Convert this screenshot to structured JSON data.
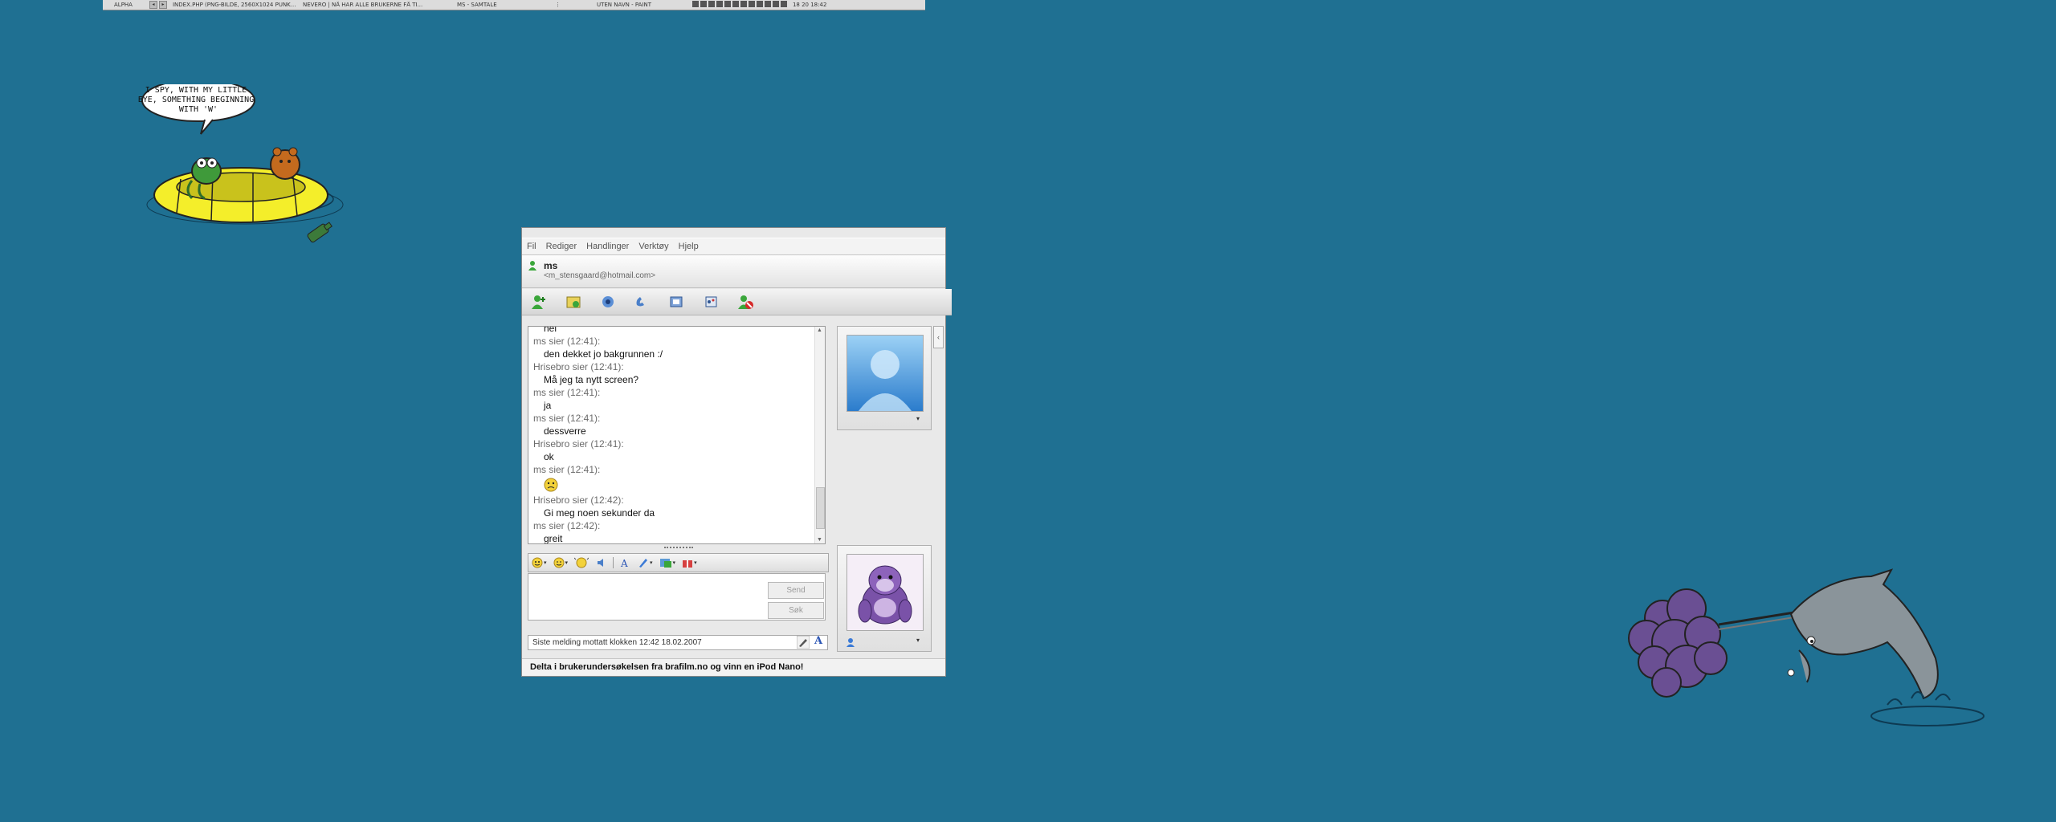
{
  "taskbar": {
    "items": [
      "ALPHA",
      "INDEX.PHP (PNG-BILDE, 2560X1024 PUNK...",
      "NEVERO | NÅ HAR ALLE BRUKERNE FÅ TI...",
      "MS - SAMTALE",
      "UTEN NAVN - PAINT"
    ],
    "clock": "18 20 18:42"
  },
  "desktop": {
    "speech_bubble_text": "I SPY, WITH MY LITTLE EYE, SOMETHING BEGINNING WITH 'W'"
  },
  "msn": {
    "menu": [
      "Fil",
      "Rediger",
      "Handlinger",
      "Verktøy",
      "Hjelp"
    ],
    "contact": {
      "name": "ms",
      "email": "<m_stensgaard@hotmail.com>"
    },
    "toolbar_icons": [
      "invite-contact-icon",
      "send-file-icon",
      "video-icon",
      "voice-icon",
      "activities-icon",
      "games-icon",
      "block-icon"
    ],
    "chat": [
      {
        "type": "msg",
        "text": "nei"
      },
      {
        "type": "sender",
        "text": "ms sier (12:41):"
      },
      {
        "type": "msg",
        "text": "den dekket jo bakgrunnen :/"
      },
      {
        "type": "sender",
        "text": "Hrisebro sier (12:41):"
      },
      {
        "type": "msg",
        "text": "Må jeg ta nytt screen?"
      },
      {
        "type": "sender",
        "text": "ms sier (12:41):"
      },
      {
        "type": "msg",
        "text": "ja"
      },
      {
        "type": "sender",
        "text": "ms sier (12:41):"
      },
      {
        "type": "msg",
        "text": "dessverre"
      },
      {
        "type": "sender",
        "text": "Hrisebro sier (12:41):"
      },
      {
        "type": "msg",
        "text": "ok"
      },
      {
        "type": "sender",
        "text": "ms sier (12:41):"
      },
      {
        "type": "emoji",
        "text": ""
      },
      {
        "type": "sender",
        "text": "Hrisebro sier (12:42):"
      },
      {
        "type": "msg",
        "text": "Gi meg noen sekunder da"
      },
      {
        "type": "sender",
        "text": "ms sier (12:42):"
      },
      {
        "type": "msg",
        "text": "greit"
      }
    ],
    "buttons": {
      "send": "Send",
      "search": "Søk"
    },
    "status_text": "Siste melding mottatt klokken 12:42 18.02.2007",
    "font_glyph": "A",
    "ad_text": "Delta i brukerundersøkelsen fra brafilm.no og vinn en iPod Nano!"
  },
  "colors": {
    "desktop": "#1f7092",
    "window": "#e9e9e9",
    "sender": "#6b6b6b"
  }
}
